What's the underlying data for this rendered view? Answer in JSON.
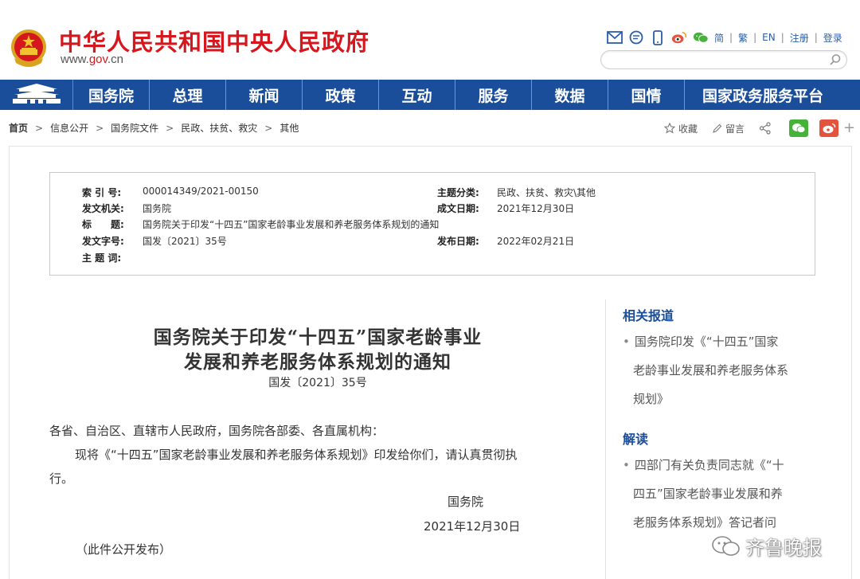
{
  "header": {
    "title": "中华人民共和国中央人民政府",
    "url_prefix": "www.",
    "url_domain": "gov",
    "url_suffix": ".cn",
    "links": [
      "简",
      "繁",
      "EN",
      "注册",
      "登录"
    ],
    "search_placeholder": ""
  },
  "nav": {
    "items": [
      "国务院",
      "总理",
      "新闻",
      "政策",
      "互动",
      "服务",
      "数据",
      "国情",
      "国家政务服务平台"
    ]
  },
  "breadcrumb": [
    "首页",
    "信息公开",
    "国务院文件",
    "民政、扶贫、救灾",
    "其他"
  ],
  "actions": {
    "favorite": "收藏",
    "comment": "留言"
  },
  "meta": {
    "index_label": "索 引 号:",
    "index_value": "000014349/2021-00150",
    "topic_label": "主题分类:",
    "topic_value": "民政、扶贫、救灾\\其他",
    "issuer_label": "发文机关:",
    "issuer_value": "国务院",
    "created_label": "成文日期:",
    "created_value": "2021年12月30日",
    "title_label": "标　　题:",
    "title_value": "国务院关于印发“十四五”国家老龄事业发展和养老服务体系规划的通知",
    "docno_label": "发文字号:",
    "docno_value": "国发〔2021〕35号",
    "published_label": "发布日期:",
    "published_value": "2022年02月21日",
    "keywords_label": "主 题 词:",
    "keywords_value": ""
  },
  "article": {
    "title_line1": "国务院关于印发“十四五”国家老龄事业",
    "title_line2": "发展和养老服务体系规划的通知",
    "doc_number": "国发〔2021〕35号",
    "salutation": "各省、自治区、直辖市人民政府，国务院各部委、各直属机构：",
    "body_line1": "现将《“十四五”国家老龄事业发展和养老服务体系规划》印发给你们，请认真贯彻执",
    "body_line2": "行。",
    "signature": "国务院",
    "date": "2021年12月30日",
    "note": "（此件公开发布）"
  },
  "sidebar": {
    "related_heading": "相关报道",
    "related_lines": [
      "国务院印发《“十四五”国家",
      "老龄事业发展和养老服务体系",
      "规划》"
    ],
    "interpret_heading": "解读",
    "interpret_lines": [
      "四部门有关负责同志就《“十",
      "四五”国家老龄事业发展和养",
      "老服务体系规划》答记者问"
    ]
  },
  "watermark": "齐鲁晚报",
  "colors": {
    "brand_red": "#d6171d",
    "nav_blue": "#1b4e9a",
    "link_blue": "#2a5ea8"
  }
}
